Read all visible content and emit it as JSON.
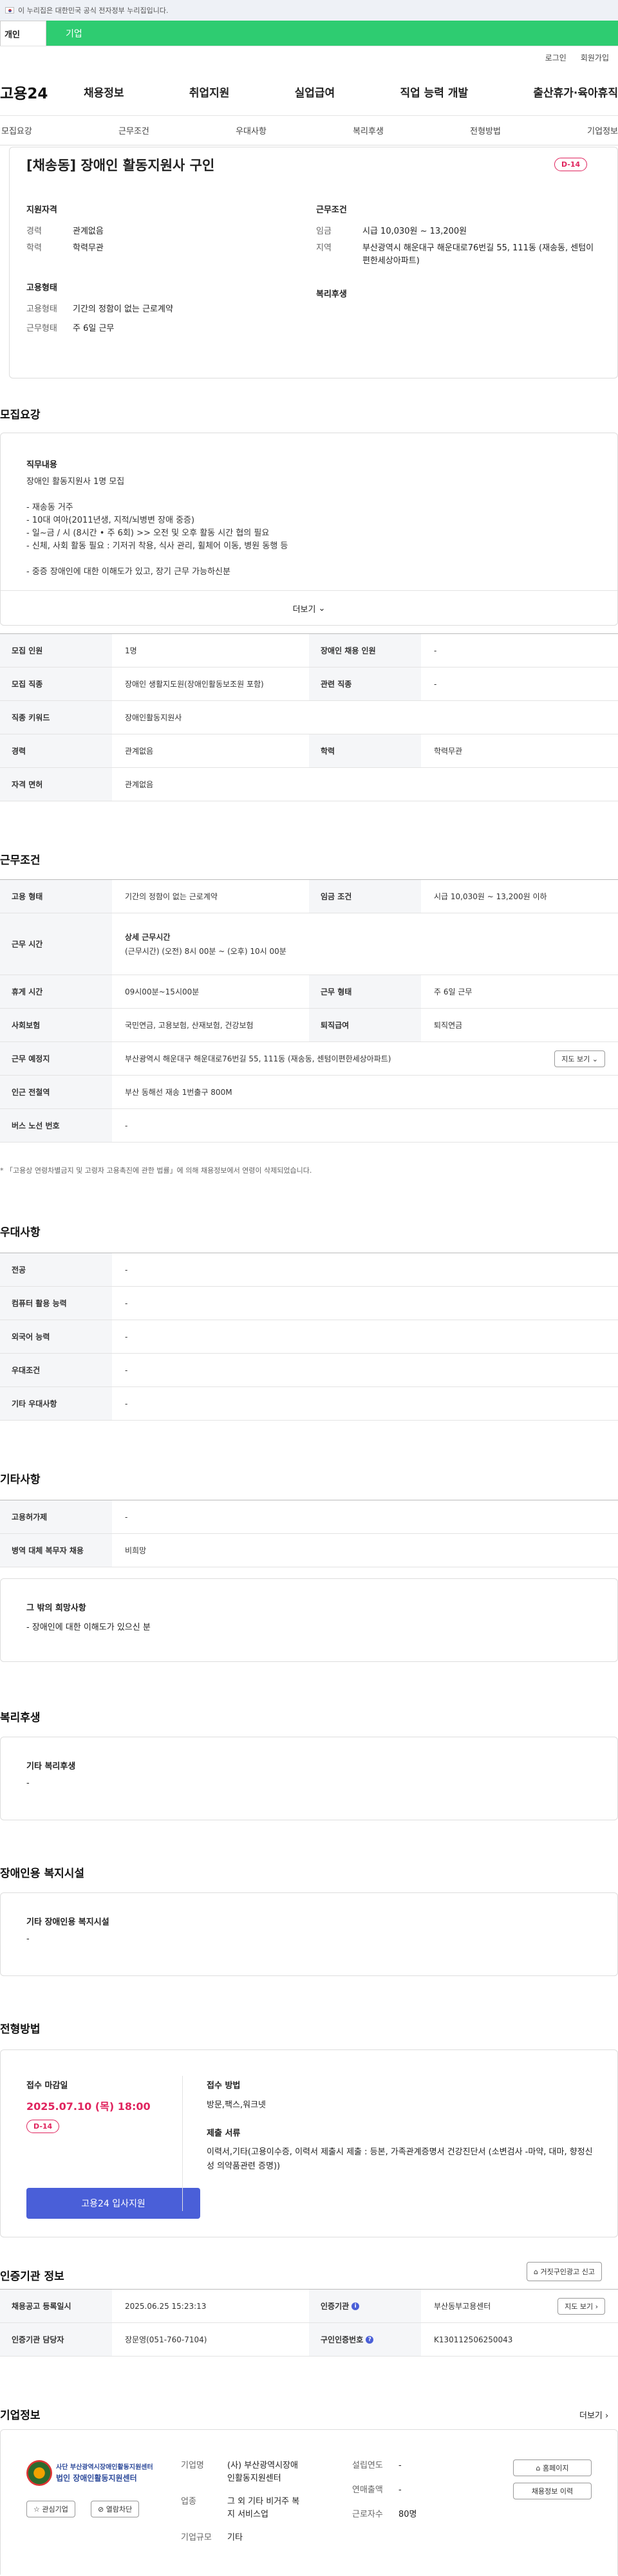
{
  "gov_banner": {
    "text": "이 누리집은 대한민국 공식 전자정부 누리집입니다."
  },
  "top_tabs": {
    "individual": "개인",
    "corporate": "기업"
  },
  "util": {
    "login": "로그인",
    "signup": "회원가입"
  },
  "logo": "고용24",
  "gnb": [
    "채용정보",
    "취업지원",
    "실업급여",
    "직업 능력 개발",
    "출산휴가·육아휴직"
  ],
  "subnav": [
    "모집요강",
    "근무조건",
    "우대사항",
    "복리후생",
    "전형방법",
    "기업정보"
  ],
  "summary": {
    "title": "[채송동] 장애인 활동지원사 구인",
    "dday": "D-14",
    "qual_title": "지원자격",
    "career_k": "경력",
    "career_v": "관계없음",
    "edu_k": "학력",
    "edu_v": "학력무관",
    "emp_title": "고용형태",
    "emptype_k": "고용형태",
    "emptype_v": "기간의 정함이 없는 근로계약",
    "worktype_k": "근무형태",
    "worktype_v": "주 6일 근무",
    "cond_title": "근무조건",
    "wage_k": "임금",
    "wage_v": "시급 10,030원 ~ 13,200원",
    "area_k": "지역",
    "area_v": "부산광역시 해운대구 해운대로76번길 55, 111동 (재송동, 센텀이편한세상아파트)",
    "welfare_title": "복리후생"
  },
  "recruit": {
    "section": "모집요강",
    "duty_title": "직무내용",
    "duty_lines": [
      "장애인 활동지원사 1명 모집",
      "",
      "- 재송동 거주",
      "- 10대 여아(2011년생, 지적/뇌병변 장애 중증)",
      "- 일~금 / 시 (8시간 • 주 6회) >> 오전 및 오후 활동 시간 협의 필요",
      "- 신체, 사회 활동 필요 : 기저귀 착용, 식사 관리, 휠체어 이동, 병원 동행 등",
      "",
      "- 중증 장애인에 대한 이해도가 있고, 장기 근무 가능하신분"
    ],
    "more": "더보기",
    "rows": [
      {
        "k1": "모집 인원",
        "v1": "1명",
        "k2": "장애인 채용 인원",
        "v2": "-"
      },
      {
        "k1": "모집 직종",
        "v1": "장애인 생활지도원(장애인활동보조원 포함)",
        "k2": "관련 직종",
        "v2": "-"
      },
      {
        "k1": "직종 키워드",
        "v1": "장애인활동지원사"
      },
      {
        "k1": "경력",
        "v1": "관계없음",
        "k2": "학력",
        "v2": "학력무관"
      },
      {
        "k1": "자격 면허",
        "v1": "관계없음"
      }
    ]
  },
  "work": {
    "section": "근무조건",
    "emptype_k": "고용 형태",
    "emptype_v": "기간의 정함이 없는 근로계약",
    "wage_k": "임금 조건",
    "wage_v": "시급 10,030원 ~ 13,200원 이하",
    "hours_k": "근무 시간",
    "hours_title": "상세 근무시간",
    "hours_v": "(근무시간) (오전) 8시 00분 ~ (오후) 10시 00분",
    "break_k": "휴게 시간",
    "break_v": "09시00분~15시00분",
    "form_k": "근무 형태",
    "form_v": "주 6일 근무",
    "ins_k": "사회보험",
    "ins_v": "국민연금, 고용보험, 산재보험, 건강보험",
    "sev_k": "퇴직급여",
    "sev_v": "퇴직연금",
    "loc_k": "근무 예정지",
    "loc_v": "부산광역시 해운대구 해운대로76번길 55, 111동 (재송동, 센텀이편한세상아파트)",
    "map_btn": "지도 보기",
    "subway_k": "인근 전철역",
    "subway_v": "부산 동해선 재송 1번출구 800M",
    "bus_k": "버스 노선 번호",
    "bus_v": "-",
    "note": "* 「고용상 연령차별금지 및 고령자 고용촉진에 관한 법률」에 의해 채용정보에서 연령이 삭제되었습니다."
  },
  "pref": {
    "section": "우대사항",
    "rows": [
      {
        "k": "전공",
        "v": "-"
      },
      {
        "k": "컴퓨터 활용 능력",
        "v": "-"
      },
      {
        "k": "외국어 능력",
        "v": "-"
      },
      {
        "k": "우대조건",
        "v": "-"
      },
      {
        "k": "기타 우대사항",
        "v": "-"
      }
    ]
  },
  "etc": {
    "section": "기타사항",
    "rows": [
      {
        "k": "고용허가제",
        "v": "-"
      },
      {
        "k": "병역 대체 복무자 채용",
        "v": "비희망"
      }
    ],
    "wish_title": "그 밖의 희망사항",
    "wish_v": "- 장애인에 대한 이해도가 있으신 분"
  },
  "welfare": {
    "section": "복리후생",
    "title": "기타 복리후생",
    "v": "-"
  },
  "facility": {
    "section": "장애인용 복지시설",
    "title": "기타 장애인용 복지시설",
    "v": "-"
  },
  "selection": {
    "section": "전형방법",
    "deadline_title": "접수 마감일",
    "deadline": "2025.07.10 (목) 18:00",
    "dday": "D-14",
    "apply": "고용24 입사지원",
    "method_title": "접수 방법",
    "method_v": "방문,팩스,워크넷",
    "docs_title": "제출 서류",
    "docs_v": "이력서,기타(고용이수증, 이력서 제출시 제출 : 등본, 가족관계증명서 건강진단서 (소변검사 -마약, 대마, 향정신성 의약품관련 증명))"
  },
  "cert": {
    "section": "인증기관 정보",
    "report_btn": "거짓구인광고 신고",
    "reg_k": "채용공고 등록일시",
    "reg_v": "2025.06.25 15:23:13",
    "org_k": "인증기관",
    "org_v": "부산동부고용센터",
    "map_btn": "지도 보기",
    "mgr_k": "인증기관 담당자",
    "mgr_v": "장문영(051-760-7104)",
    "no_k": "구인인증번호",
    "no_v": "K130112506250043"
  },
  "company": {
    "section": "기업정보",
    "more": "더보기",
    "logo_line1": "사단 부산광역시장애인활동지원센터",
    "logo_line2": "법인 장애인활동지원센터",
    "fav_btn": "관심기업",
    "block_btn": "열람차단",
    "name_k": "기업명",
    "name_v": "(사) 부산광역시장애인활동지원센터",
    "founded_k": "설립연도",
    "founded_v": "-",
    "biz_k": "업종",
    "biz_v": "그 외 기타 비거주 복지 서비스업",
    "sales_k": "연매출액",
    "sales_v": "-",
    "emp_k": "근로자수",
    "emp_v": "80명",
    "size_k": "기업규모",
    "size_v": "기타",
    "home_btn": "홈페이지",
    "jobs_btn": "채용정보 이력"
  }
}
